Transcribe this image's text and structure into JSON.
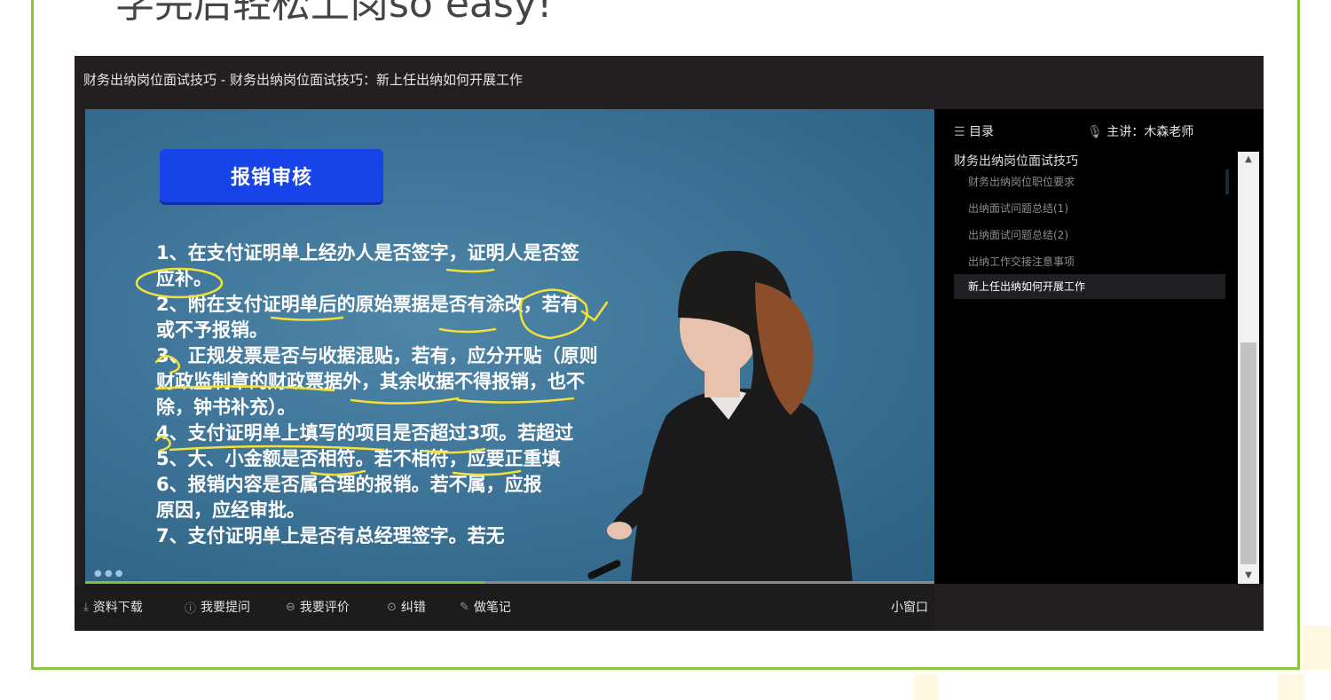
{
  "page": {
    "heading": "学完后轻松上岗so easy!",
    "accent_color": "#8cc63f"
  },
  "player": {
    "title": "财务出纳岗位面试技巧 - 财务出纳岗位面试技巧：新上任出纳如何开展工作",
    "progress_fraction": 0.47,
    "slide": {
      "title": "报销审核",
      "lines": [
        "1、在支付证明单上经办人是否签字，证明人是否签",
        "应补。",
        "2、附在支付证明单后的原始票据是否有涂改，若有",
        "或不予报销。",
        "3、正规发票是否与收据混贴，若有，应分开贴（原则",
        "财政监制章的财政票据外，其余收据不得报销，也不",
        "除，钟书补充）。",
        "4、支付证明单上填写的项目是否超过3项。若超过",
        "5、大、小金额是否相符。若不相符，应要正重填",
        "6、报销内容是否属合理的报销。若不属，应报",
        "原因，应经审批。",
        "7、支付证明单上是否有总经理签字。若无"
      ]
    },
    "controls": {
      "download": "资料下载",
      "ask": "我要提问",
      "review": "我要评价",
      "report": "纠错",
      "notes": "做笔记",
      "mini_window": "小窗口"
    },
    "sidebar": {
      "catalog_label": "目录",
      "teacher_label": "主讲：木森老师",
      "course_name": "财务出纳岗位面试技巧",
      "lessons": [
        {
          "label": "财务出纳岗位职位要求",
          "active": false
        },
        {
          "label": "出纳面试问题总结(1)",
          "active": false
        },
        {
          "label": "出纳面试问题总结(2)",
          "active": false
        },
        {
          "label": "出纳工作交接注意事项",
          "active": false
        },
        {
          "label": "新上任出纳如何开展工作",
          "active": true
        }
      ]
    }
  },
  "icons": {
    "download": "download-icon",
    "ask": "question-icon",
    "review": "comment-icon",
    "report": "target-icon",
    "notes": "pen-icon",
    "catalog": "list-icon",
    "teacher": "microphone-icon"
  }
}
